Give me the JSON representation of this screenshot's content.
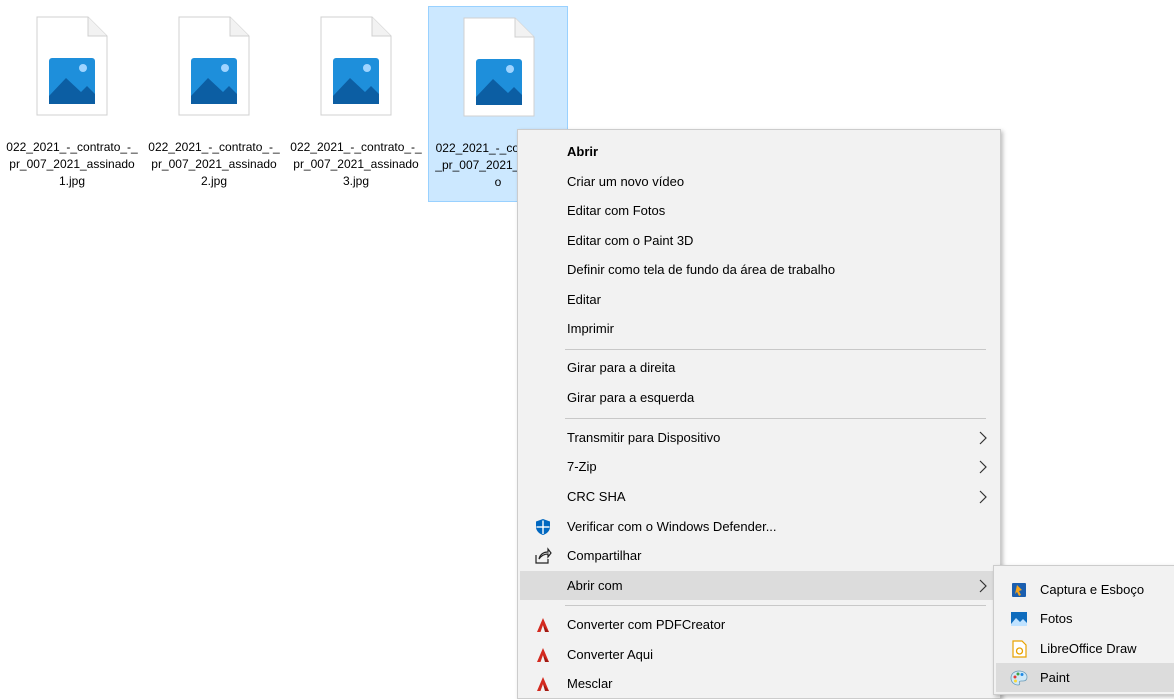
{
  "files": [
    {
      "name": "022_2021_-_contrato_-_pr_007_2021_assinado1.jpg",
      "selected": false
    },
    {
      "name": "022_2021_-_contrato_-_pr_007_2021_assinado2.jpg",
      "selected": false
    },
    {
      "name": "022_2021_-_contrato_-_pr_007_2021_assinado3.jpg",
      "selected": false
    },
    {
      "name": "022_2021_-_contrato_-_pr_007_2021_assinado",
      "selected": true
    }
  ],
  "context_menu": {
    "open": "Abrir",
    "new_video": "Criar um novo vídeo",
    "edit_photos": "Editar com Fotos",
    "edit_paint3d": "Editar com o Paint 3D",
    "set_wallpaper": "Definir como tela de fundo da área de trabalho",
    "edit": "Editar",
    "print": "Imprimir",
    "rotate_right": "Girar para a direita",
    "rotate_left": "Girar para a esquerda",
    "cast": "Transmitir para Dispositivo",
    "zip": "7-Zip",
    "crc": "CRC SHA",
    "defender": "Verificar com o Windows Defender...",
    "share": "Compartilhar",
    "open_with": "Abrir com",
    "pdf_convert": "Converter com PDFCreator",
    "convert_here": "Converter Aqui",
    "merge": "Mesclar"
  },
  "open_with_submenu": {
    "snip": "Captura e Esboço",
    "photos": "Fotos",
    "libre_draw": "LibreOffice Draw",
    "paint": "Paint"
  },
  "colors": {
    "selection_bg": "#cce8ff",
    "menu_bg": "#f2f2f2",
    "highlight": "#dcdcdc",
    "pdfcreator_red": "#d42a1f",
    "defender_blue": "#0067c0"
  }
}
